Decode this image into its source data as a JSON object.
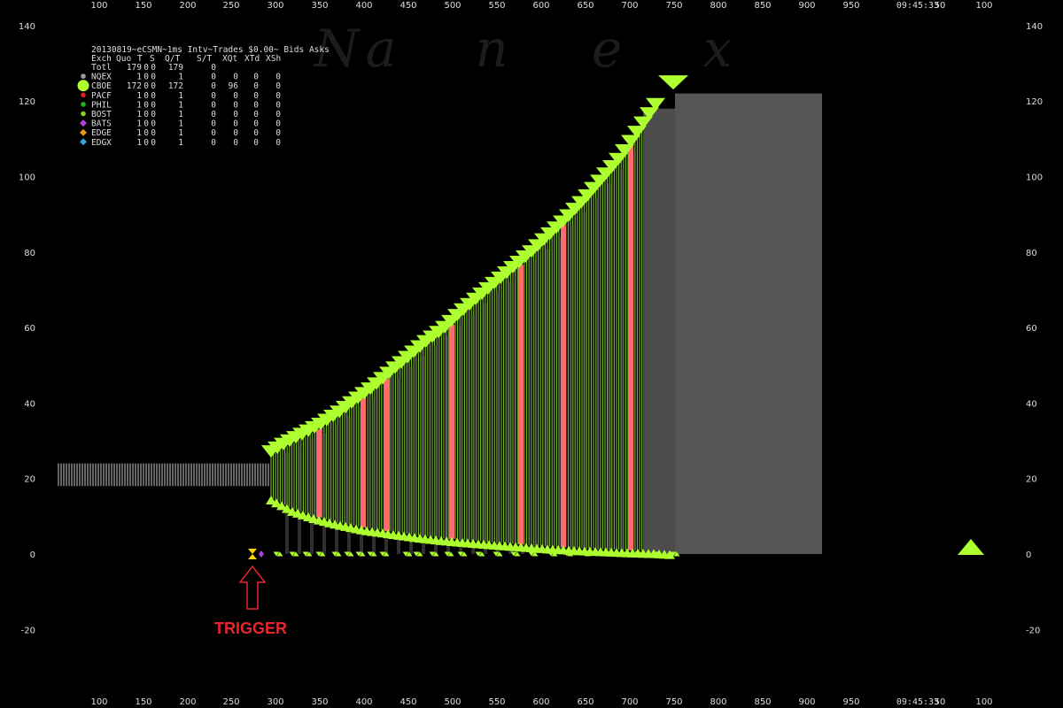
{
  "colors": {
    "background": "#000000",
    "ask_triangle": "#adff2f",
    "bid_triangle": "#adff2f",
    "spread_green": "#8ee02a",
    "spread_red": "#ff6b6b",
    "spread_gray": "#555555",
    "pre_band": "#aaaaaa",
    "trigger_arrow": "#e6262c"
  },
  "chart_data": {
    "type": "line",
    "xlim": [
      65,
      1130
    ],
    "ylim": [
      -28,
      141
    ],
    "x_ticks": [
      "100",
      "150",
      "200",
      "250",
      "300",
      "350",
      "400",
      "450",
      "500",
      "550",
      "600",
      "650",
      "700",
      "750",
      "800",
      "850",
      "900",
      "950",
      "09:45:33",
      "50",
      "100"
    ],
    "y_ticks": [
      140,
      120,
      100,
      80,
      60,
      40,
      20,
      0,
      -20
    ],
    "title": "20130819~eCSMN~1ms Intv~Trades $0.00~ Bids  Asks",
    "watermark": "N a n e x",
    "pre_trigger_band": {
      "x_start": 66,
      "x_end": 305,
      "bid": 18,
      "ask": 24
    },
    "ask_series": {
      "name": "Asks",
      "x": [
        306,
        320,
        340,
        360,
        380,
        400,
        420,
        440,
        460,
        480,
        500,
        520,
        540,
        560,
        580,
        600,
        620,
        640,
        660,
        680,
        700,
        720,
        740
      ],
      "values": [
        26,
        28,
        30.5,
        33,
        36,
        39.5,
        43,
        47,
        51,
        55,
        58.5,
        63,
        67,
        71,
        75,
        79,
        83.5,
        88,
        93,
        98.5,
        104,
        111,
        118
      ]
    },
    "bid_series": {
      "name": "Bids",
      "x": [
        306,
        330,
        355,
        380,
        410,
        440,
        470,
        500,
        530,
        560,
        590,
        620,
        650,
        680,
        710,
        740,
        760
      ],
      "values": [
        15,
        12,
        10,
        8.5,
        7,
        6,
        5,
        4.2,
        3.6,
        3,
        2.5,
        2,
        1.6,
        1.3,
        1,
        0.8,
        0.5
      ]
    },
    "red_spreads_x": [
      360,
      410,
      437,
      510,
      588,
      636,
      712
    ],
    "final_quote": {
      "x_start": 762,
      "x_end": 928,
      "bid": 0,
      "ask": 122
    },
    "trades_x": [
      312,
      330,
      345,
      360,
      378,
      392,
      405,
      418,
      432,
      458,
      470,
      488,
      505,
      520,
      540,
      560,
      580,
      600,
      622,
      640,
      660,
      688,
      705,
      720,
      740,
      760
    ],
    "extra_ask_markers": [
      {
        "x": 760,
        "y": 124
      },
      {
        "x": 1096,
        "y": 0
      }
    ],
    "legend": {
      "headers": [
        "Exch",
        "Quo",
        "T",
        "S",
        "Q/T",
        "S/T",
        "XQt",
        "XTd",
        "XSh"
      ],
      "rows": [
        {
          "exch": "Totl",
          "quo": "179",
          "t": "0",
          "s": "0",
          "qt": "179",
          "st": "0",
          "xqt": "",
          "xtd": "",
          "xsh": "",
          "color": "",
          "marker": ""
        },
        {
          "exch": "NQEX",
          "quo": "1",
          "t": "0",
          "s": "0",
          "qt": "1",
          "st": "0",
          "xqt": "0",
          "xtd": "0",
          "xsh": "0",
          "color": "#9a9a9a",
          "marker": "circle"
        },
        {
          "exch": "CBOE",
          "quo": "172",
          "t": "0",
          "s": "0",
          "qt": "172",
          "st": "0",
          "xqt": "96",
          "xtd": "0",
          "xsh": "0",
          "color": "#adff2f",
          "marker": "circle-large"
        },
        {
          "exch": "PACF",
          "quo": "1",
          "t": "0",
          "s": "0",
          "qt": "1",
          "st": "0",
          "xqt": "0",
          "xtd": "0",
          "xsh": "0",
          "color": "#e02020",
          "marker": "circle"
        },
        {
          "exch": "PHIL",
          "quo": "1",
          "t": "0",
          "s": "0",
          "qt": "1",
          "st": "0",
          "xqt": "0",
          "xtd": "0",
          "xsh": "0",
          "color": "#22b022",
          "marker": "circle"
        },
        {
          "exch": "BOST",
          "quo": "1",
          "t": "0",
          "s": "0",
          "qt": "1",
          "st": "0",
          "xqt": "0",
          "xtd": "0",
          "xsh": "0",
          "color": "#8bd020",
          "marker": "circle"
        },
        {
          "exch": "BATS",
          "quo": "1",
          "t": "0",
          "s": "0",
          "qt": "1",
          "st": "0",
          "xqt": "0",
          "xtd": "0",
          "xsh": "0",
          "color": "#b040e0",
          "marker": "diamond"
        },
        {
          "exch": "EDGE",
          "quo": "1",
          "t": "0",
          "s": "0",
          "qt": "1",
          "st": "0",
          "xqt": "0",
          "xtd": "0",
          "xsh": "0",
          "color": "#e09a10",
          "marker": "diamond"
        },
        {
          "exch": "EDGX",
          "quo": "1",
          "t": "0",
          "s": "0",
          "qt": "1",
          "st": "0",
          "xqt": "0",
          "xtd": "0",
          "xsh": "0",
          "color": "#3aa0d8",
          "marker": "diamond"
        }
      ]
    },
    "annotation": {
      "label": "TRIGGER",
      "x": 285
    }
  }
}
